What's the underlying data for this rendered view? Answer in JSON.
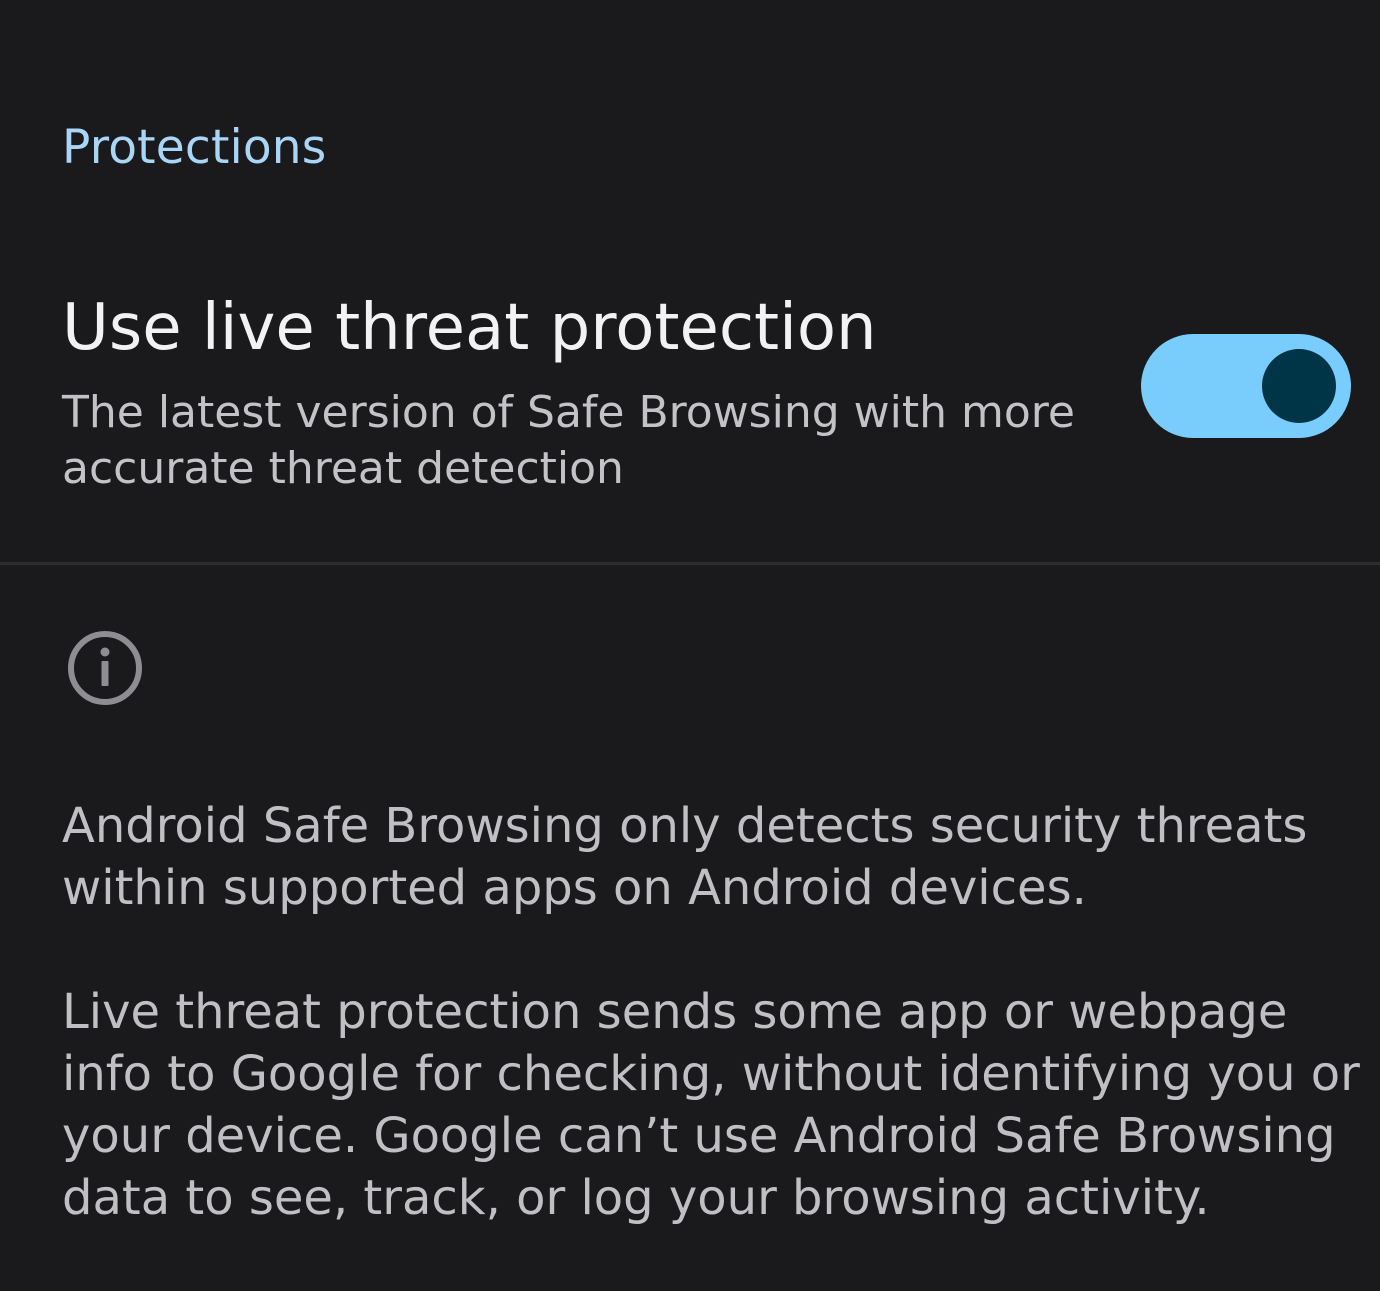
{
  "section": {
    "title": "Protections"
  },
  "setting": {
    "title": "Use live threat protection",
    "summary": "The latest version of Safe Browsing with more accurate threat detection",
    "toggle_state": "on",
    "toggle_track_color": "#78cdfd",
    "toggle_thumb_color": "#003548"
  },
  "footer": {
    "icon": "info-icon",
    "paragraphs": [
      "Android Safe Browsing only detects security threats within supported apps on Android devices.",
      "Live threat protection sends some app or webpage info to Google for checking, without identifying you or your device. Google can’t use Android Safe Browsing data to see, track, or log your browsing activity."
    ]
  },
  "colors": {
    "background": "#1a1a1c",
    "accent": "#a9d6f7"
  }
}
